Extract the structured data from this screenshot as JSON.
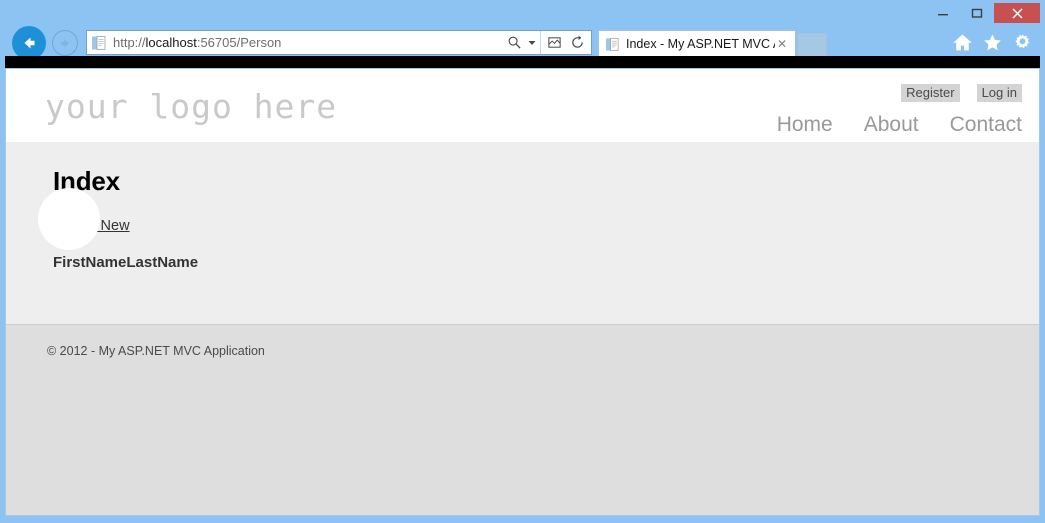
{
  "browser": {
    "window_controls": {
      "minimize_label": "–",
      "maximize_label": "❑",
      "close_label": "✕"
    },
    "back_button_label": "←",
    "forward_button_label": "→",
    "address": {
      "url_scheme": "http://",
      "url_host": "localhost",
      "url_rest": ":56705/Person",
      "full_url": "http://localhost:56705/Person",
      "favicon_name": "page-icon",
      "search_icon": "magnifier-icon",
      "dropdown_icon": "chevron-down-icon",
      "compat_icon": "compatibility-view-icon",
      "refresh_icon": "refresh-icon"
    },
    "tab": {
      "title": "Index - My ASP.NET MVC A...",
      "favicon_name": "page-icon",
      "close_label": "✕"
    },
    "new_tab_label": "",
    "toolbar_icons": [
      {
        "name": "home-icon",
        "label": "Home"
      },
      {
        "name": "favorites-star-icon",
        "label": "Favorites"
      },
      {
        "name": "settings-gear-icon",
        "label": "Tools"
      }
    ]
  },
  "page": {
    "logo_text": "your logo here",
    "auth_links": [
      {
        "label": "Register"
      },
      {
        "label": "Log in"
      }
    ],
    "nav_links": [
      {
        "label": "Home"
      },
      {
        "label": "About"
      },
      {
        "label": "Contact"
      }
    ],
    "title": "Index",
    "create_link_label": "Create New",
    "table": {
      "columns": [
        "FirstName",
        "LastName"
      ],
      "rows": []
    },
    "footer_text": "© 2012 - My ASP.NET MVC Application"
  },
  "colors": {
    "chrome_blue": "#8cc3f2",
    "close_red": "#c75050",
    "back_blue": "#1e90d8",
    "content_gray": "#eeeeee",
    "footer_gray": "#dedede",
    "logo_gray": "#c9c9c9",
    "nav_gray": "#999999",
    "highlight_gray": "#d4d4d4"
  }
}
